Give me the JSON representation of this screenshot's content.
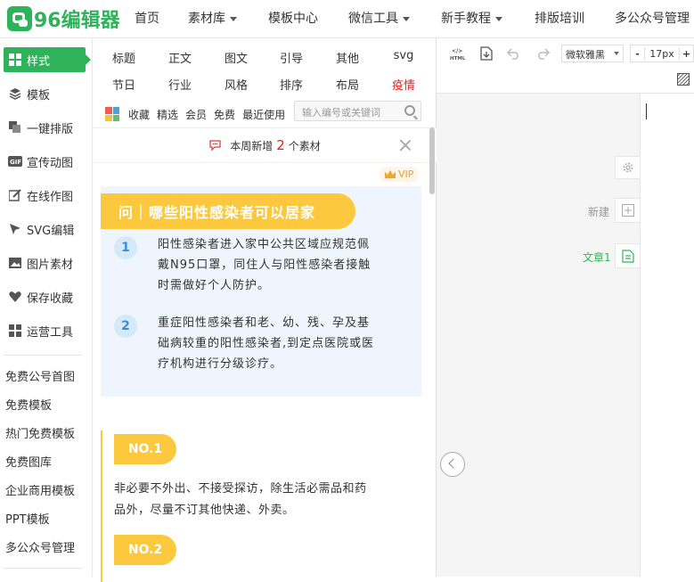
{
  "brand": {
    "logo_text": "96编辑器",
    "accent": "#2eb35a",
    "yellow": "#fbc83e"
  },
  "topnav": {
    "items": [
      "首页",
      "素材库",
      "模板中心",
      "微信工具",
      "新手教程",
      "排版培训",
      "多公众号管理"
    ]
  },
  "sidebar": {
    "items": [
      "样式",
      "模板",
      "一键排版",
      "宣传动图",
      "在线作图",
      "SVG编辑",
      "图片素材",
      "保存收藏",
      "运营工具"
    ],
    "links": [
      "免费公号首图",
      "免费模板",
      "热门免费模板",
      "免费图库",
      "企业商用模板",
      "PPT模板",
      "多公众号管理"
    ]
  },
  "categories": {
    "row1": [
      "标题",
      "正文",
      "图文",
      "引导",
      "其他",
      "svg"
    ],
    "row2": [
      "节日",
      "行业",
      "风格",
      "排序",
      "布局",
      "疫情"
    ]
  },
  "filters": [
    "收藏",
    "精选",
    "会员",
    "免费",
    "最近使用"
  ],
  "search": {
    "placeholder": "输入编号或关键词"
  },
  "notice": {
    "prefix": "本周新增",
    "count": "2",
    "suffix": "个素材"
  },
  "vip_label": "VIP",
  "card1": {
    "title": "问｜哪些阳性感染者可以居家",
    "items": [
      {
        "num": "1",
        "lines": [
          "阳性感染者进入家中公共区域应规范佩",
          "戴N95口罩，同住人与阳性感染者接触",
          "时需做好个人防护。"
        ]
      },
      {
        "num": "2",
        "lines": [
          "重症阳性感染者和老、幼、残、孕及基",
          "础病较重的阳性感染者,到定点医院或医",
          "疗机构进行分级诊疗。"
        ]
      }
    ]
  },
  "card2": {
    "badge1": "NO.1",
    "text1": [
      "非必要不外出、不接受探访，除生活必需品和药",
      "品外，尽量不订其他快递、外卖。"
    ],
    "badge2": "NO.2"
  },
  "editor": {
    "font": "微软雅黑",
    "size_minus": "-",
    "size": "17px",
    "size_plus": "+",
    "new_label": "新建",
    "article_label": "文章1"
  }
}
